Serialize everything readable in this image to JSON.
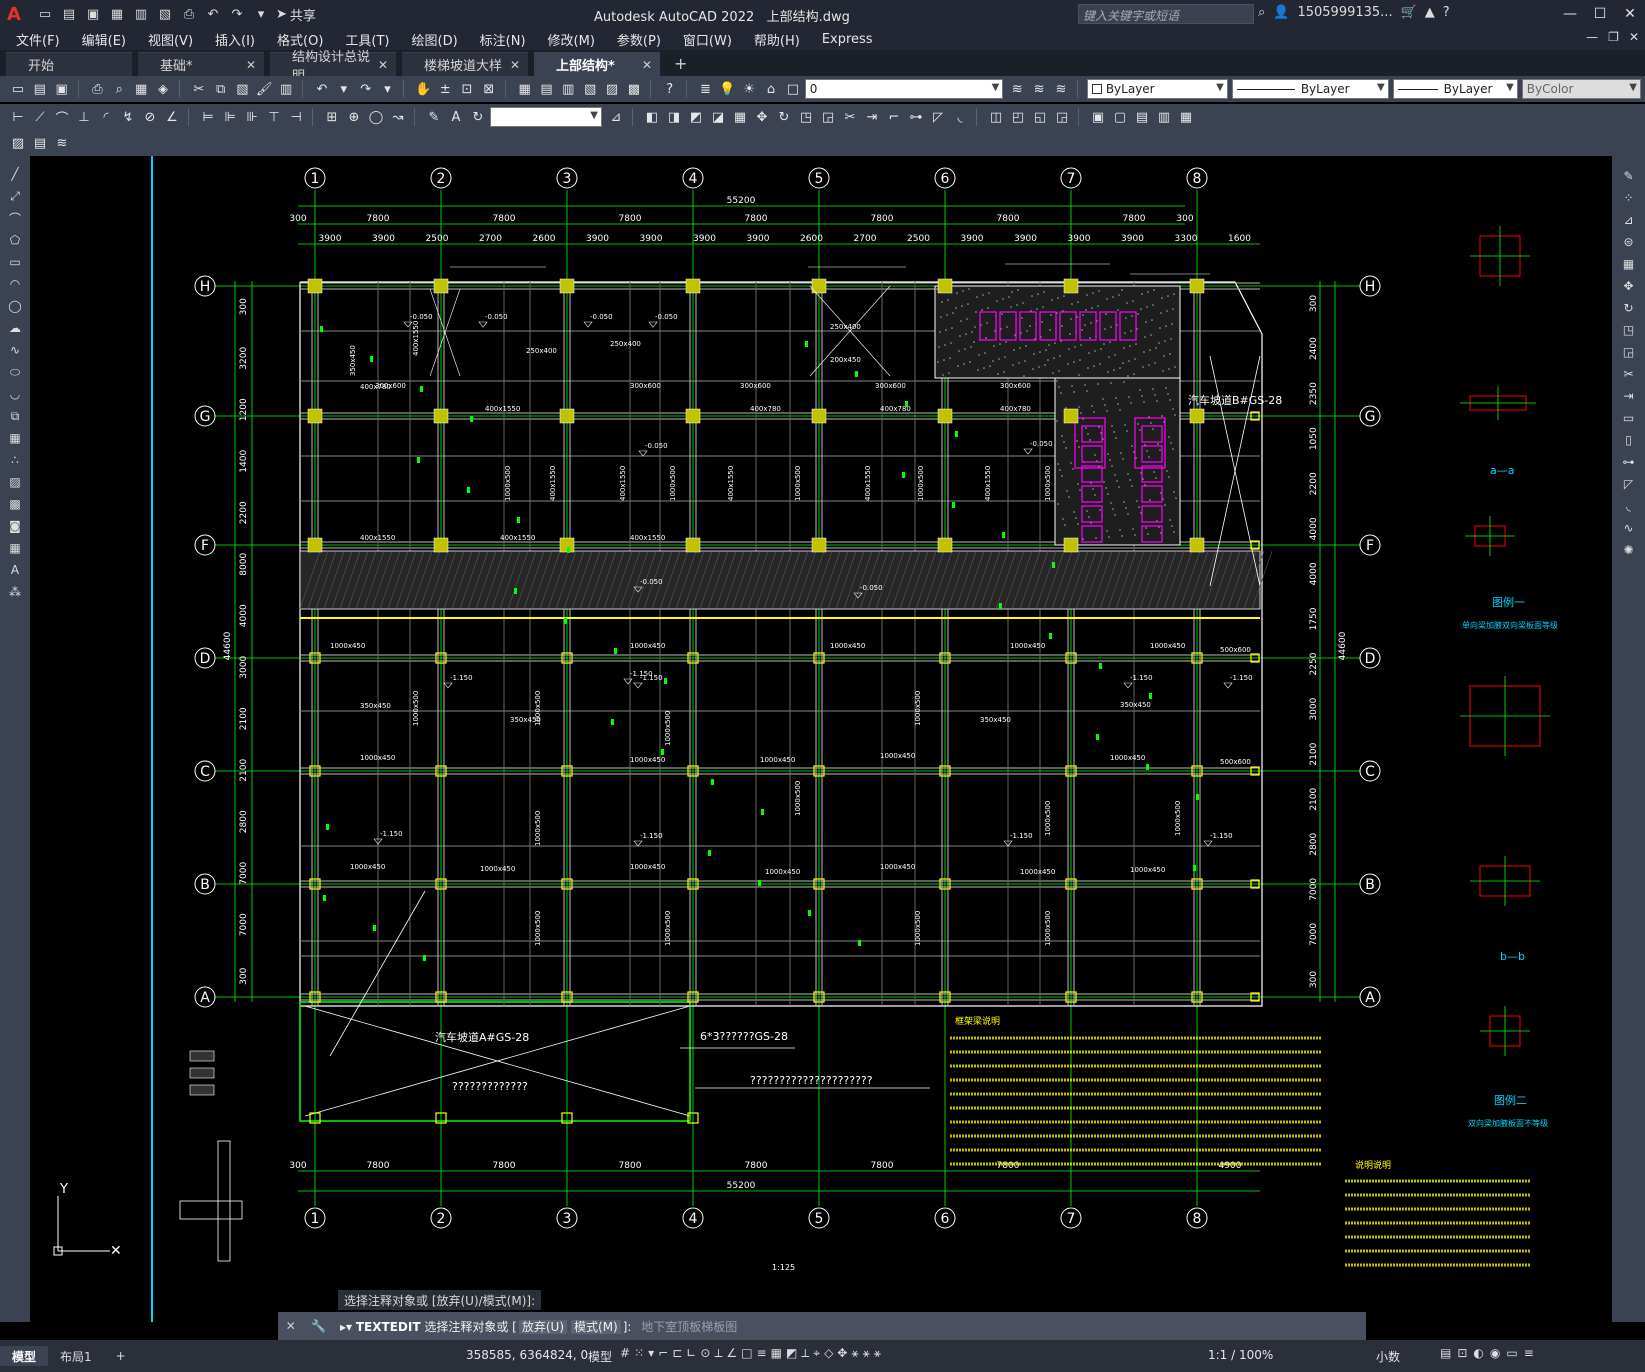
{
  "titlebar": {
    "logo": "A",
    "share": "共享",
    "app_title": "Autodesk AutoCAD 2022",
    "file_name": "上部结构.dwg",
    "search_placeholder": "键入关键字或短语",
    "user": "1505999135...",
    "help": "?"
  },
  "menu": [
    "文件(F)",
    "编辑(E)",
    "视图(V)",
    "插入(I)",
    "格式(O)",
    "工具(T)",
    "绘图(D)",
    "标注(N)",
    "修改(M)",
    "参数(P)",
    "窗口(W)",
    "帮助(H)",
    "Express"
  ],
  "tabs": [
    {
      "label": "开始",
      "active": false,
      "closable": false
    },
    {
      "label": "基础*",
      "active": false,
      "closable": true
    },
    {
      "label": "结构设计总说明",
      "active": false,
      "closable": true
    },
    {
      "label": "楼梯坡道大样",
      "active": false,
      "closable": true
    },
    {
      "label": "上部结构*",
      "active": true,
      "closable": true
    }
  ],
  "properties": {
    "layer": "0",
    "color": "ByLayer",
    "linetype": "ByLayer",
    "lineweight": "ByLayer",
    "plotstyle": "ByColor"
  },
  "drawing": {
    "col_labels": [
      "1",
      "2",
      "3",
      "4",
      "5",
      "6",
      "7",
      "8"
    ],
    "row_labels": [
      "H",
      "G",
      "F",
      "D",
      "C",
      "B",
      "A"
    ],
    "top_total": "55200",
    "top_dims": [
      "300",
      "7800",
      "7800",
      "7800",
      "7800",
      "7800",
      "7800",
      "7800",
      "300"
    ],
    "top_sub_dims": [
      "3900",
      "3900",
      "2500",
      "2700",
      "2600",
      "3900",
      "3900",
      "3900",
      "3900",
      "2600",
      "2700",
      "2500",
      "3900",
      "3900",
      "3900",
      "3900",
      "3300",
      "1600"
    ],
    "bottom_total": "55200",
    "bottom_dims": [
      "300",
      "7800",
      "7800",
      "7800",
      "7800",
      "7800",
      "7800",
      "4900"
    ],
    "left_total": "44600",
    "right_total": "44600",
    "left_dims": [
      "300",
      "3200",
      "1200",
      "1400",
      "2200",
      "8000",
      "4000",
      "3000",
      "2100",
      "2100",
      "2800",
      "7000",
      "7000",
      "300"
    ],
    "right_dims": [
      "300",
      "2400",
      "2350",
      "1050",
      "2200",
      "4000",
      "4000",
      "1750",
      "2250",
      "3000",
      "2100",
      "2100",
      "2800",
      "7000",
      "7000",
      "300"
    ],
    "annotations": {
      "ramp_b": "汽车坡道B#GS-28",
      "ramp_a": "汽车坡道A#GS-28",
      "ref_1": "6*3??????GS-28",
      "ref_2": "?????????????",
      "ref_3": "?????????????????????",
      "notes_title": "框架梁说明",
      "legend_1": "图例一",
      "legend_1_sub": "单向梁加腋双向梁板面等级",
      "legend_2": "图例二",
      "legend_2_sub": "双向梁加腋板面不等级",
      "section_aa": "a—a",
      "section_bb": "b—b",
      "notes2_title": "说明说明"
    },
    "beam_labels": [
      "400x780",
      "400x1550",
      "300x600",
      "1000x450",
      "350x450",
      "500x600",
      "1000x500",
      "250x400",
      "200x450"
    ],
    "elevations": [
      "-0.050",
      "-1.150"
    ]
  },
  "cmd": {
    "history": "选择注释对象或 [放弃(U)/模式(M)]:",
    "command": "TEXTEDIT",
    "prompt": "选择注释对象或",
    "kw_undo": "放弃(U)",
    "kw_mode": "模式(M)",
    "input_text": "地下室顶板梯板图",
    "scale": "1:125"
  },
  "status": {
    "layout_tabs": [
      "模型",
      "布局1"
    ],
    "coords": "358585, 6364824, 0",
    "model": "模型",
    "annot_scale": "1:1 / 100%",
    "units": "小数"
  },
  "colors": {
    "grid": "#00ff00",
    "column": "#c2c200",
    "beam": "#ffffff",
    "magenta": "#ff00ff",
    "cyan": "#00d4ff",
    "yellow": "#ffff00",
    "red": "#ff0000",
    "titlebar": "#222733",
    "toolbar": "#3b4252"
  }
}
